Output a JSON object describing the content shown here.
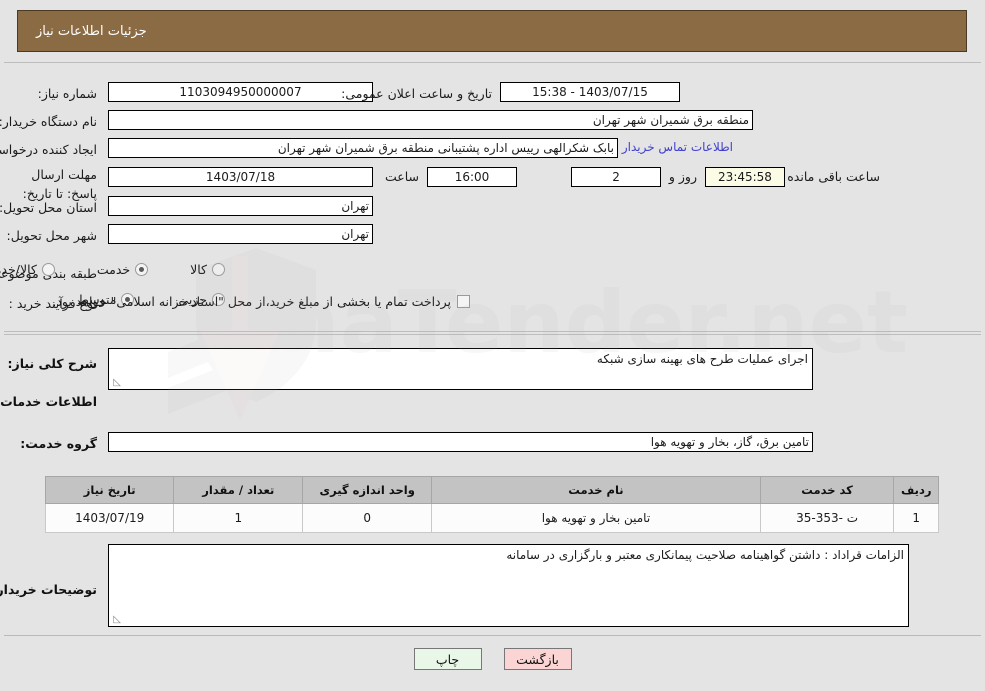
{
  "header": {
    "title": "جزئیات اطلاعات نیاز"
  },
  "form": {
    "need_number_label": "شماره نیاز:",
    "need_number_value": "1103094950000007",
    "announce_datetime_label": "تاریخ و ساعت اعلان عمومی:",
    "announce_datetime_value": "1403/07/15 - 15:38",
    "buyer_org_label": "نام دستگاه خریدار:",
    "buyer_org_value": "منطقه برق شمیران شهر تهران",
    "requester_label": "ایجاد کننده درخواست:",
    "requester_value": "بابک شکرالهی رییس اداره پشتیبانی منطقه برق شمیران شهر تهران",
    "buyer_contact_link": "اطلاعات تماس خریدار",
    "deadline_label": "مهلت ارسال پاسخ: تا تاریخ:",
    "deadline_date_value": "1403/07/18",
    "deadline_time_label": "ساعت",
    "deadline_time_value": "16:00",
    "remaining_days_value": "2",
    "remaining_days_label": "روز و",
    "remaining_time_value": "23:45:58",
    "remaining_time_label": "ساعت باقی مانده",
    "province_label": "استان محل تحویل:",
    "province_value": "تهران",
    "city_label": "شهر محل تحویل:",
    "city_value": "تهران",
    "category_label": "طبقه بندی موضوعی:",
    "category_options": [
      {
        "label": "کالا",
        "selected": false
      },
      {
        "label": "خدمت",
        "selected": true
      },
      {
        "label": "کالا/خدمت",
        "selected": false
      }
    ],
    "process_label": "نوع فرآیند خرید :",
    "process_options": [
      {
        "label": "جزیی",
        "selected": false
      },
      {
        "label": "متوسط",
        "selected": true
      }
    ],
    "treasury_checkbox_checked": false,
    "treasury_checkbox_label": "پرداخت تمام یا بخشی از مبلغ خرید،از محل \"اسناد خزانه اسلامی\" خواهد بود."
  },
  "description": {
    "label": "شرح کلی نیاز:",
    "value": "اجرای عملیات طرح های بهینه سازی شبکه"
  },
  "services": {
    "section_title": "اطلاعات خدمات مورد نیاز",
    "group_label": "گروه خدمت:",
    "group_value": "تامین برق، گاز، بخار و تهویه هوا",
    "table": {
      "columns": [
        "ردیف",
        "کد خدمت",
        "نام خدمت",
        "واحد اندازه گیری",
        "تعداد / مقدار",
        "تاریخ نیاز"
      ],
      "rows": [
        {
          "row_no": "1",
          "service_code": "ت -353-35",
          "service_name": "تامین بخار و تهویه هوا",
          "unit": "0",
          "quantity": "1",
          "need_date": "1403/07/19"
        }
      ]
    }
  },
  "buyer_notes": {
    "label": "توضیحات خریدار:",
    "value": "الزامات قراداد : داشتن گواهینامه صلاحیت پیمانکاری معتبر و بارگزاری در سامانه"
  },
  "footer": {
    "print_label": "چاپ",
    "back_label": "بازگشت"
  },
  "watermark": {
    "text": "AnaTender.net"
  },
  "colors": {
    "header_bg": "#8b6b43",
    "page_bg": "#e4e4e4",
    "link": "#4040d0",
    "countdown_bg": "#fbfbe6",
    "print_btn_bg": "#e9f7e9",
    "back_btn_bg": "#fbd4d4",
    "table_header_bg": "#c3c3c3"
  }
}
